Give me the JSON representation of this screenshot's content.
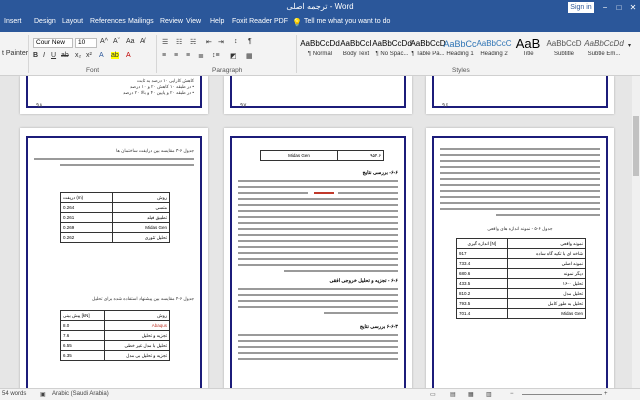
{
  "window": {
    "title": "ترجمه اصلی - Word",
    "sign_in": "Sign in",
    "minimize": "−",
    "maximize": "□",
    "close": "✕"
  },
  "tabs": [
    "Insert",
    "Design",
    "Layout",
    "References",
    "Mailings",
    "Review",
    "View",
    "Help",
    "Foxit Reader PDF"
  ],
  "tell_me": "Tell me what you want to do",
  "ribbon": {
    "format_painter": "t Painter",
    "font": "Cour New",
    "font_size": "10",
    "groups": {
      "font": "Font",
      "paragraph": "Paragraph",
      "styles": "Styles"
    },
    "styles": [
      {
        "sample": "AaBbCcDd",
        "name": "¶ Normal"
      },
      {
        "sample": "AaBbCcI",
        "name": "Body Text"
      },
      {
        "sample": "AaBbCcDd",
        "name": "¶ No Spac..."
      },
      {
        "sample": "AaBbCcD",
        "name": "¶ Table Pa..."
      },
      {
        "sample": "AaBbCc",
        "name": "Heading 1"
      },
      {
        "sample": "AaBbCcC",
        "name": "Heading 2"
      },
      {
        "sample": "AaB",
        "name": "Title"
      },
      {
        "sample": "AaBbCcD",
        "name": "Subtitle"
      },
      {
        "sample": "AaBbCcDd",
        "name": "Subtle Em..."
      }
    ]
  },
  "pages": {
    "left": {
      "top_number": "۹۸",
      "bottom_number": "۹۷",
      "top_lines": [
        "کاهش کارایی ۱۰ درصد به ثابت",
        "• در طبقه ۱۰ کاهش ۲۰ و ۱۰ درصد",
        "• در طبقه ۲۰ و پایین ۴۰ و بالا ۲۰ درصد"
      ],
      "caption1": "جدول ۶-۳ مقایسه بین درایفت ساختمان ها",
      "table1": [
        [
          "دریفت (m)",
          "روش"
        ],
        [
          "0.264",
          "متسی"
        ],
        [
          "0.261",
          "تطبیق فیلد"
        ],
        [
          "0.269",
          "Midas Gen"
        ],
        [
          "0.262",
          "تحلیل تئوری"
        ]
      ],
      "caption2": "جدول ۶-۴ مقایسه بین پیشنهاد استفاده شده برای تحلیل",
      "table2": [
        [
          "پیش بینی [kN]",
          "روش"
        ],
        [
          "8.0",
          "Abaqus"
        ],
        [
          "7.6",
          "تجزیه و تحلیل"
        ],
        [
          "6.55",
          "تحلیل با مدل غیر خطی"
        ],
        [
          "6.35",
          "تجزیه و تحلیل بی مدل"
        ]
      ]
    },
    "middle": {
      "top_number": "۹۷",
      "bottom_number": "۹۸",
      "header_box": [
        "Midas Gen",
        "۹۵۴.۶"
      ],
      "heading1": "۶-۶- بررسی نتایج",
      "heading2": "۶-۶ - تجزیه و تحلیل خروجی افقی",
      "heading3": "۶-۶-۳ بررسی نتایج"
    },
    "right": {
      "top_number": "۹۶",
      "bottom_number": "۹۹",
      "table_caption": "جدول ۶-۵ - نمونه اندازه های واقعی",
      "table": [
        [
          "نمونه واقعی",
          "اندازه گیری [N]"
        ],
        [
          "شاخه ای با تکیه گاه ساده",
          "917"
        ],
        [
          "نمونه اصلی",
          "733.4"
        ],
        [
          "دیگر نمونه",
          "680.6"
        ],
        [
          "تحلیل ۰-۱۶",
          "433.5"
        ],
        [
          "تحلیل مدل",
          "810.2"
        ],
        [
          "تحلیل به طور کامل",
          "793.5"
        ],
        [
          "Midas Gen",
          "701.4"
        ]
      ]
    }
  },
  "status": {
    "words": "54 words",
    "language": "Arabic (Saudi Arabia)"
  }
}
